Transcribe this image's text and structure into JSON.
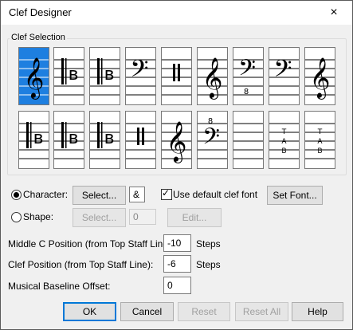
{
  "window": {
    "title": "Clef Designer",
    "close_icon": "×"
  },
  "clef_selection": {
    "label": "Clef Selection",
    "selected_index": 0,
    "row1": [
      "treble-clef",
      "c-clef",
      "c-clef",
      "bass-clef",
      "percussion-clef",
      "treble-clef",
      "bass-clef-8vb",
      "bass-clef",
      "treble-clef"
    ],
    "row2": [
      "c-clef",
      "c-clef",
      "c-clef",
      "percussion-clef",
      "treble-clef-8vb",
      "bass-clef-8va",
      "blank",
      "tab-clef",
      "tab-clef"
    ]
  },
  "character": {
    "label": "Character:",
    "select_button": "Select...",
    "value": "&",
    "use_default_label": "Use default clef font",
    "use_default_checked": true,
    "set_font_button": "Set Font..."
  },
  "shape": {
    "label": "Shape:",
    "select_button": "Select...",
    "value": "0",
    "edit_button": "Edit..."
  },
  "middle_c": {
    "label": "Middle C Position (from Top Staff Line):",
    "value": "-10",
    "unit": "Steps"
  },
  "clef_position": {
    "label": "Clef Position (from Top Staff Line):",
    "value": "-6",
    "unit": "Steps"
  },
  "baseline": {
    "label": "Musical Baseline Offset:",
    "value": "0"
  },
  "buttons": {
    "ok": "OK",
    "cancel": "Cancel",
    "reset": "Reset",
    "reset_all": "Reset All",
    "help": "Help"
  }
}
